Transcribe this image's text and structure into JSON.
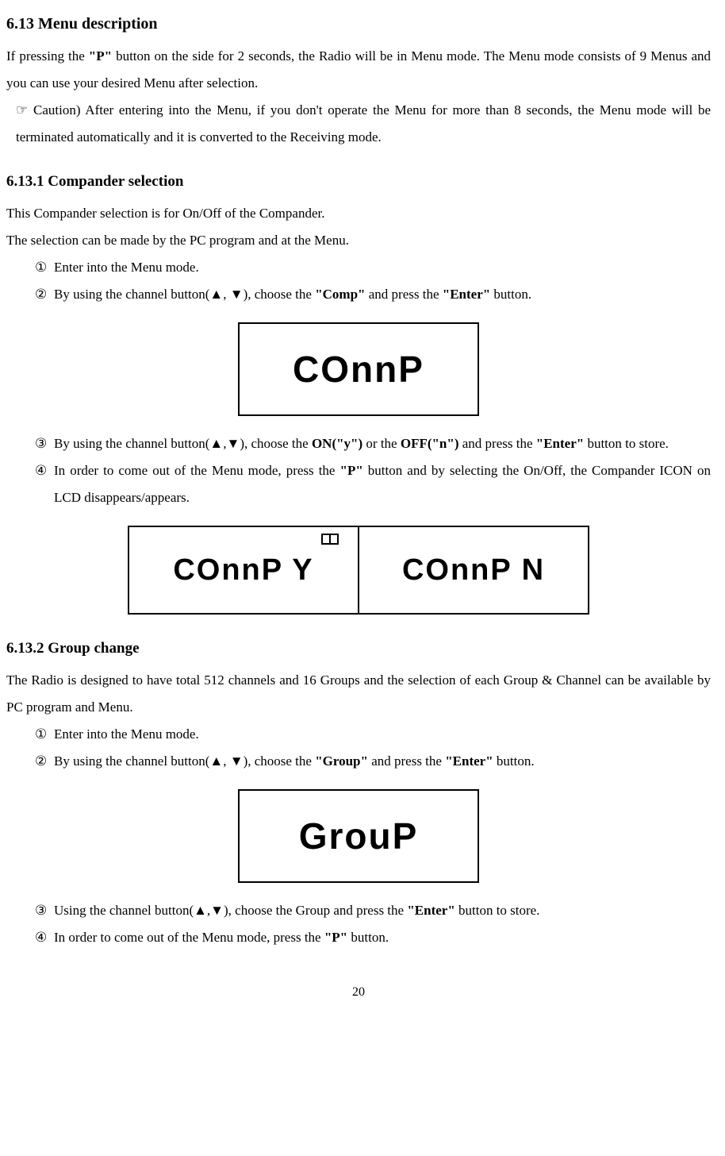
{
  "s613": {
    "heading": "6.13 Menu description",
    "p1a": "If pressing the ",
    "p1b": "\"P\"",
    "p1c": " button on the side for 2 seconds, the Radio will be in Menu mode. The Menu mode consists of 9 Menus and you can use your desired Menu after selection.",
    "caution": "☞ Caution) After entering into the Menu, if you don't operate the Menu for more than 8 seconds, the Menu mode will be terminated automatically and it is converted to the Receiving mode."
  },
  "s6131": {
    "heading": "6.13.1 Compander selection",
    "p1": "This Compander selection is for On/Off of the Compander.",
    "p2": "The selection can be made by the PC program and at the Menu.",
    "i1n": "①",
    "i1": "Enter into the Menu mode.",
    "i2n": "②",
    "i2a": "By using the channel button(▲, ▼), choose the ",
    "i2b": "\"Comp\"",
    "i2c": " and press the ",
    "i2d": "\"Enter\"",
    "i2e": " button.",
    "lcd1": "COnnP",
    "i3n": "③",
    "i3a": "By using the channel button(▲,▼), choose the ",
    "i3b": "ON(\"y\")",
    "i3c": " or the ",
    "i3d": "OFF(\"n\")",
    "i3e": " and press the ",
    "i3f": "\"Enter\"",
    "i3g": " button to store.",
    "i4n": "④",
    "i4a": "In order to come out of the Menu mode, press the ",
    "i4b": "\"P\"",
    "i4c": " button and by selecting the On/Off, the Compander ICON on LCD disappears/appears.",
    "lcd2": "COnnP Y",
    "lcd3": "COnnP N"
  },
  "s6132": {
    "heading": "6.13.2 Group change",
    "p1": "The Radio is designed to have total 512 channels and 16 Groups and the selection of each Group & Channel can be available by PC program and Menu.",
    "i1n": "①",
    "i1": " Enter into the Menu mode.",
    "i2n": "②",
    "i2a": " By using the channel button(▲, ▼), choose the ",
    "i2b": "\"Group\"",
    "i2c": " and press the ",
    "i2d": "\"Enter\"",
    "i2e": " button.",
    "lcd": "GrouP",
    "i3n": "③",
    "i3a": "  Using the channel button(▲,▼), choose the Group and press the ",
    "i3b": "\"Enter\"",
    "i3c": " button to store.",
    "i4n": "④",
    "i4a": "  In order to come out of the Menu mode, press the ",
    "i4b": "\"P\"",
    "i4c": " button."
  },
  "page": "20"
}
